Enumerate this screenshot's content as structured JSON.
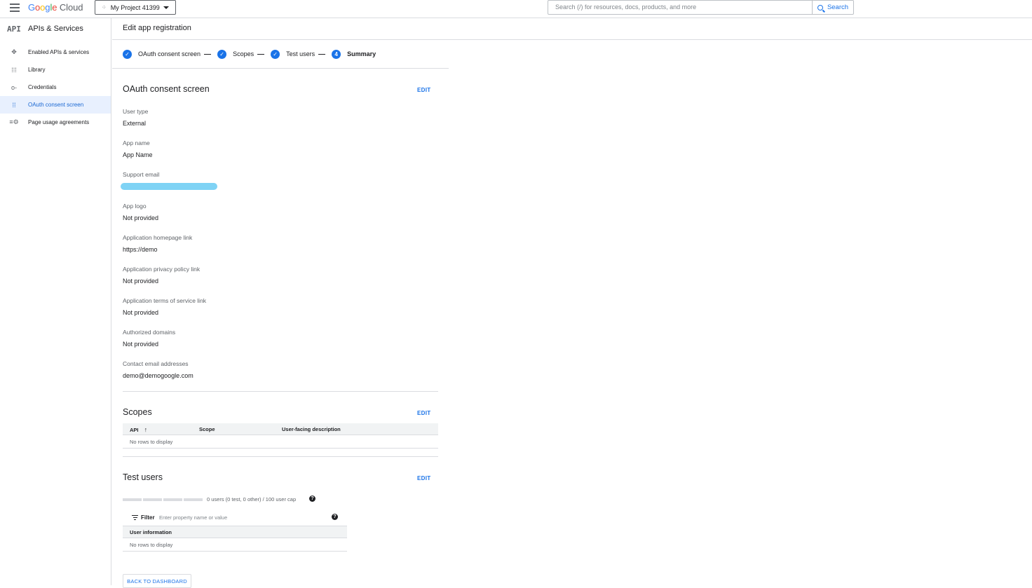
{
  "topbar": {
    "logo_google": [
      "G",
      "o",
      "o",
      "g",
      "l",
      "e"
    ],
    "logo_cloud": "Cloud",
    "project": "My Project 41399",
    "search_placeholder": "Search (/) for resources, docs, products, and more",
    "search_button": "Search"
  },
  "sidebar": {
    "api_badge": "API",
    "title": "APIs & Services",
    "items": [
      {
        "label": "Enabled APIs & services",
        "icon": "✥"
      },
      {
        "label": "Library",
        "icon": "⁞⁞⁞"
      },
      {
        "label": "Credentials",
        "icon": "o-"
      },
      {
        "label": "OAuth consent screen",
        "icon": "⁞⁞",
        "active": true
      },
      {
        "label": "Page usage agreements",
        "icon": "≡⚙"
      }
    ]
  },
  "header": {
    "title": "Edit app registration"
  },
  "stepper": {
    "steps": [
      {
        "label": "OAuth consent screen",
        "marker": "✓"
      },
      {
        "label": "Scopes",
        "marker": "✓"
      },
      {
        "label": "Test users",
        "marker": "✓"
      },
      {
        "label": "Summary",
        "marker": "4"
      }
    ]
  },
  "oauth": {
    "title": "OAuth consent screen",
    "edit": "EDIT",
    "fields": [
      {
        "label": "User type",
        "value": "External"
      },
      {
        "label": "App name",
        "value": "App Name"
      },
      {
        "label": "Support email",
        "value": ""
      },
      {
        "label": "App logo",
        "value": "Not provided"
      },
      {
        "label": "Application homepage link",
        "value": "https://demo"
      },
      {
        "label": "Application privacy policy link",
        "value": "Not provided"
      },
      {
        "label": "Application terms of service link",
        "value": "Not provided"
      },
      {
        "label": "Authorized domains",
        "value": "Not provided"
      },
      {
        "label": "Contact email addresses",
        "value": "demo@demogoogle.com"
      }
    ]
  },
  "scopes": {
    "title": "Scopes",
    "edit": "EDIT",
    "columns": [
      "API",
      "Scope",
      "User-facing description"
    ],
    "sort_icon": "↑",
    "empty": "No rows to display"
  },
  "test_users": {
    "title": "Test users",
    "edit": "EDIT",
    "progress": 0,
    "cap_text": "0 users (0 test, 0 other) / 100 user cap",
    "help": "?",
    "filter_label": "Filter",
    "filter_placeholder": "Enter property name or value",
    "column": "User information",
    "empty": "No rows to display"
  },
  "back_button": "BACK TO DASHBOARD",
  "colors": {
    "accent": "#1a73e8",
    "active_bg": "#e8f0fe",
    "redaction": "#7fd3f5"
  }
}
